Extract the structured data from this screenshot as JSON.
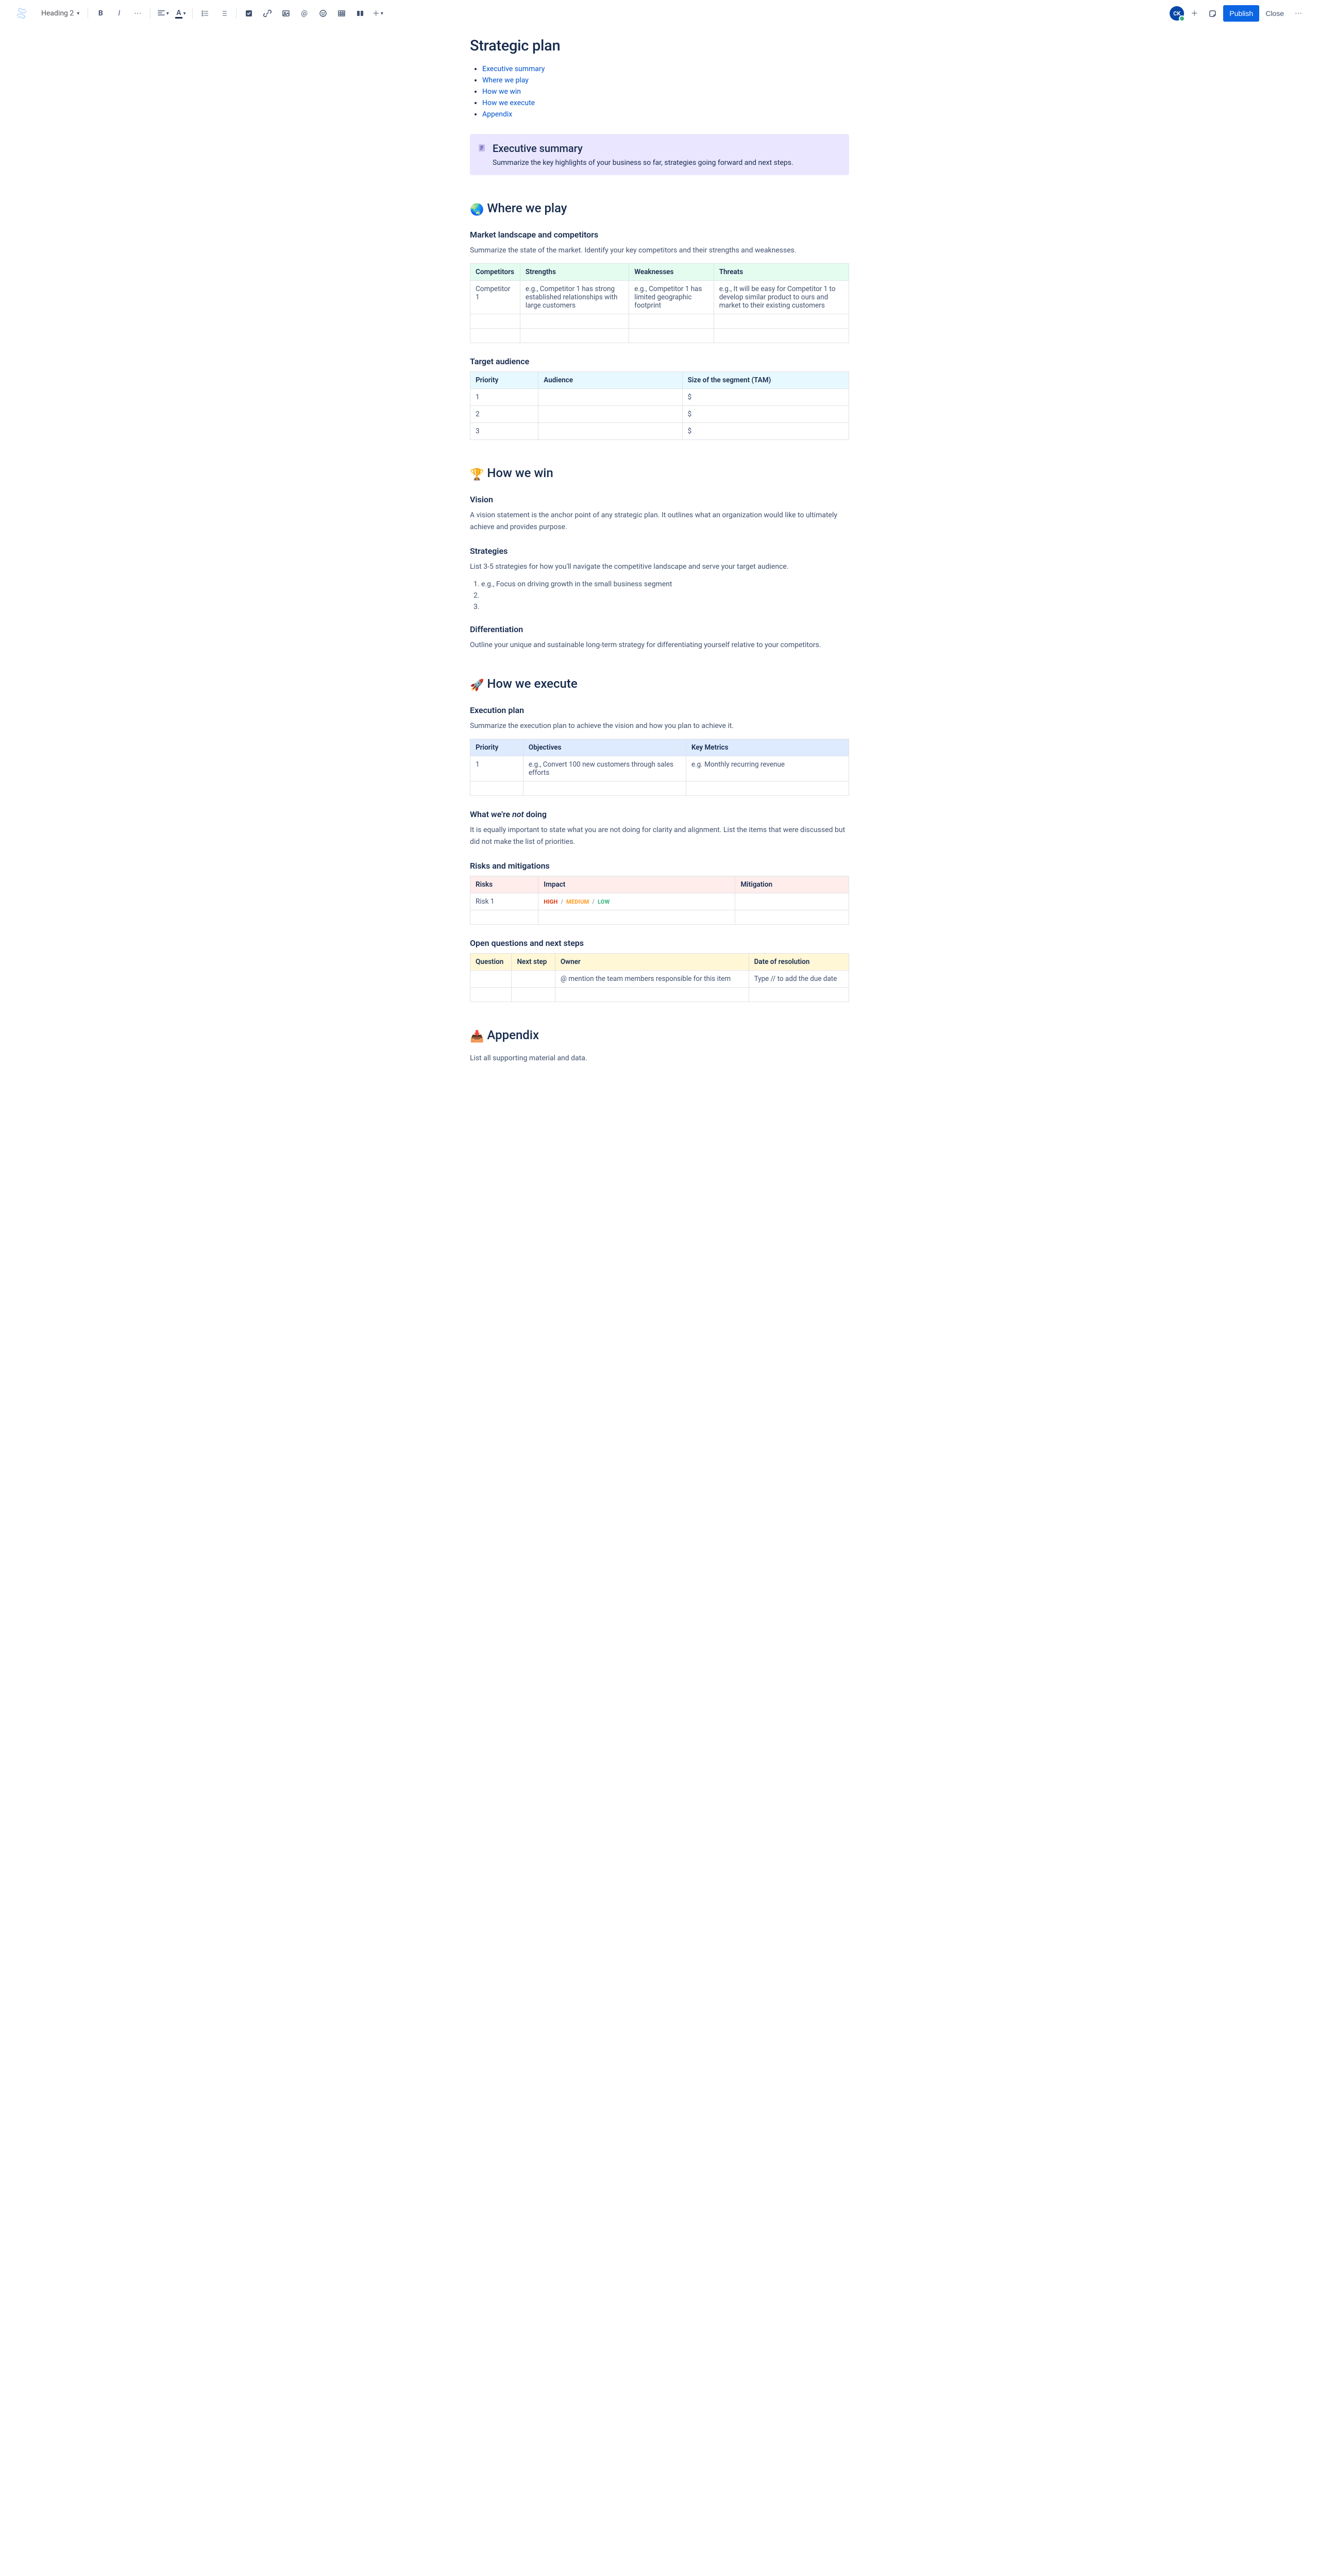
{
  "toolbar": {
    "heading_selector": "Heading 2",
    "avatar": "CK",
    "publish": "Publish",
    "close": "Close"
  },
  "page_title": "Strategic plan",
  "toc": [
    "Executive summary",
    "Where we play",
    "How we win",
    "How we execute",
    "Appendix"
  ],
  "exec_summary": {
    "title": "Executive summary",
    "body": "Summarize the key highlights of your business so far, strategies going forward and next steps."
  },
  "where_we_play": {
    "emoji": "🌏",
    "title": "Where we play",
    "market": {
      "heading": "Market landscape and competitors",
      "body": "Summarize the state of the market. Identify your key competitors and their strengths and weaknesses.",
      "cols": [
        "Competitors",
        "Strengths",
        "Weaknesses",
        "Threats"
      ],
      "rows": [
        {
          "c": "Competitor 1",
          "s": "e.g., Competitor 1 has strong established relationships with large customers",
          "w": "e.g., Competitor 1 has limited geographic footprint",
          "t": "e.g., It will be easy for Competitor 1 to develop similar product to ours and market to their existing customers"
        },
        {
          "c": "",
          "s": "",
          "w": "",
          "t": ""
        },
        {
          "c": "",
          "s": "",
          "w": "",
          "t": ""
        }
      ]
    },
    "audience": {
      "heading": "Target audience",
      "cols": [
        "Priority",
        "Audience",
        "Size of the segment (TAM)"
      ],
      "rows": [
        {
          "p": "1",
          "a": "",
          "s": "$"
        },
        {
          "p": "2",
          "a": "",
          "s": "$"
        },
        {
          "p": "3",
          "a": "",
          "s": "$"
        }
      ]
    }
  },
  "how_we_win": {
    "emoji": "🏆",
    "title": "How we win",
    "vision": {
      "heading": "Vision",
      "body": "A vision statement is the anchor point of any strategic plan. It outlines what an organization would like to ultimately achieve and provides purpose."
    },
    "strategies": {
      "heading": "Strategies",
      "body": "List 3-5 strategies for how you'll navigate the competitive landscape and serve your target audience.",
      "items": [
        "e.g., Focus on driving growth in the small business segment",
        "",
        ""
      ]
    },
    "diff": {
      "heading": "Differentiation",
      "body": "Outline your unique and sustainable long-term strategy for differentiating yourself relative to your competitors."
    }
  },
  "how_we_execute": {
    "emoji": "🚀",
    "title": "How we execute",
    "plan": {
      "heading": "Execution plan",
      "body": "Summarize the execution plan to achieve the vision and how you plan to achieve it.",
      "cols": [
        "Priority",
        "Objectives",
        "Key Metrics"
      ],
      "rows": [
        {
          "p": "1",
          "o": "e.g., Convert 100 new customers through sales efforts",
          "k": "e.g. Monthly recurring revenue"
        },
        {
          "p": "",
          "o": "",
          "k": ""
        }
      ]
    },
    "not_doing": {
      "heading_pre": "What we're ",
      "heading_em": "not",
      "heading_post": " doing",
      "body": "It is equally important to state what you are not doing for clarity and alignment. List the items that were discussed but did not make the list of priorities."
    },
    "risks": {
      "heading": "Risks and mitigations",
      "cols": [
        "Risks",
        "Impact",
        "Mitigation"
      ],
      "rows": [
        {
          "r": "Risk 1",
          "impact": {
            "high": "HIGH",
            "med": "MEDIUM",
            "low": "LOW"
          },
          "m": ""
        },
        {
          "r": "",
          "impact": null,
          "m": ""
        }
      ]
    },
    "questions": {
      "heading": "Open questions and next steps",
      "cols": [
        "Question",
        "Next step",
        "Owner",
        "Date of resolution"
      ],
      "rows": [
        {
          "q": "",
          "n": "",
          "o": "@ mention the team members responsible for this item",
          "d": "Type // to add the due date"
        },
        {
          "q": "",
          "n": "",
          "o": "",
          "d": ""
        }
      ]
    }
  },
  "appendix": {
    "emoji": "📥",
    "title": "Appendix",
    "body": "List all supporting material and data."
  }
}
